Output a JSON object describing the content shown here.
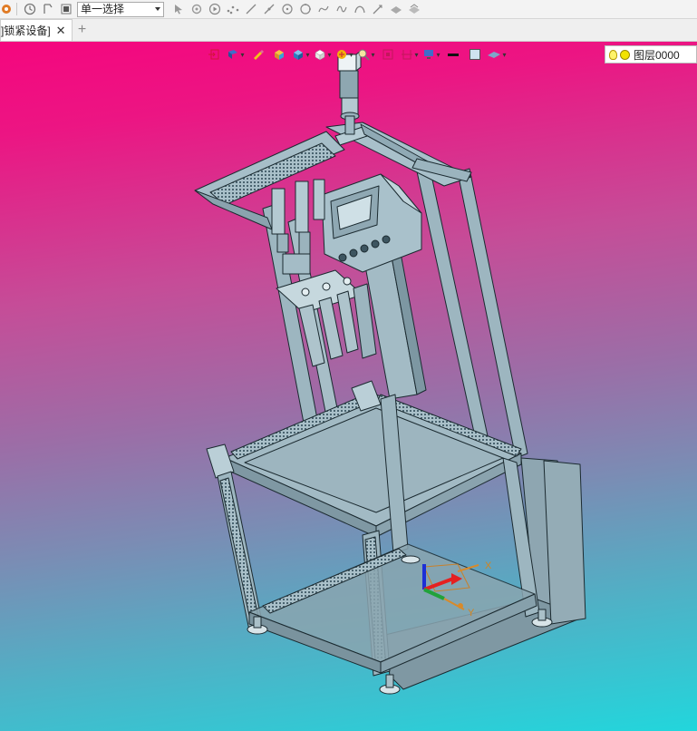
{
  "toolbar": {
    "selection_mode": "单一选择",
    "icons": [
      "app-icon",
      "history-icon",
      "filter-icon",
      "stop-icon",
      "pointer-icon",
      "pick-icon",
      "play-icon",
      "points-icon",
      "line-icon",
      "line-tool-icon",
      "circle-center-icon",
      "circle-icon",
      "spline-icon",
      "curve-icon",
      "arc-icon",
      "arrow-line-icon",
      "surface-icon",
      "surface-edit-icon"
    ]
  },
  "tabs": [
    {
      "label": "[打锁紧设备]",
      "visible_label": "]锁紧设备]",
      "active": true
    }
  ],
  "tab_close": "✕",
  "tab_add": "+",
  "viewbar": {
    "icons": [
      "exit-icon",
      "view-orient-icon",
      "pencil-icon",
      "cube-shade-icon",
      "cube-blue-icon",
      "cube-white-icon",
      "sun-filter-icon",
      "zoom-icon",
      "fit-icon",
      "section-icon",
      "display-icon",
      "line-color-icon",
      "fill-color-icon",
      "plane-icon"
    ]
  },
  "layer": {
    "label": "图层0000"
  },
  "triad": {
    "x_label": "X",
    "y_label": "Y"
  },
  "colors": {
    "bg_top": "#f5067e",
    "bg_bottom": "#22d6dc",
    "model_fill": "#9fb8c2",
    "model_dark": "#5e7a86",
    "model_line": "#1b2a30"
  }
}
